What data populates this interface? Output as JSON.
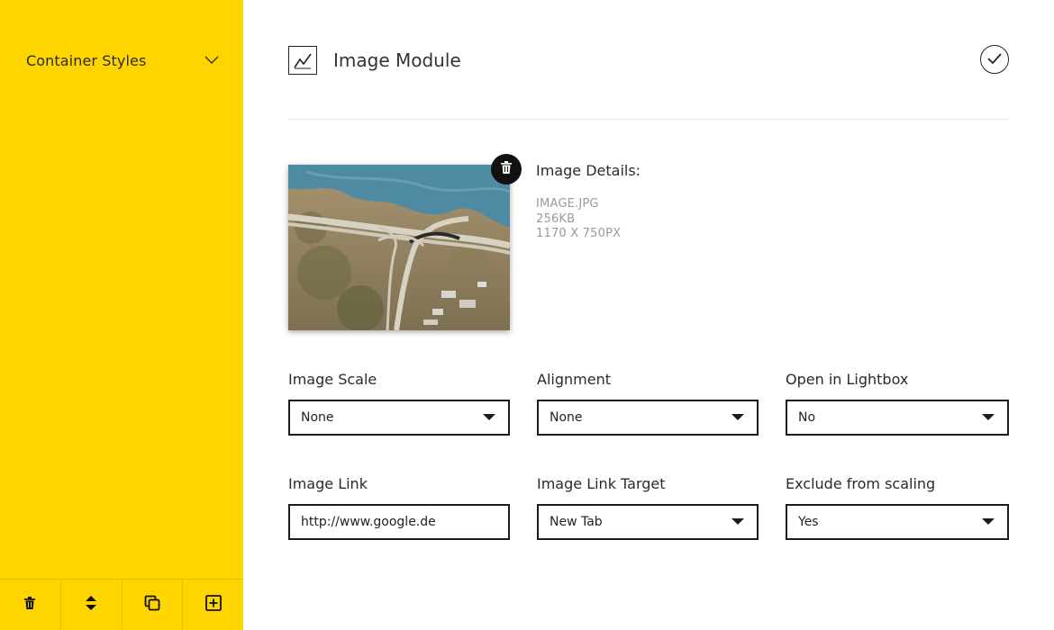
{
  "sidebar": {
    "section_label": "Container Styles",
    "toolbar": [
      {
        "name": "delete-container-button",
        "icon": "trash-icon"
      },
      {
        "name": "move-container-button",
        "icon": "move-updown-icon"
      },
      {
        "name": "duplicate-container-button",
        "icon": "copy-icon"
      },
      {
        "name": "add-container-button",
        "icon": "plus-square-icon"
      }
    ]
  },
  "module": {
    "title": "Image Module",
    "icon": "image-chart-icon",
    "confirm_icon": "check-circle-icon"
  },
  "image": {
    "details_title": "Image Details:",
    "filename": "IMAGE.JPG",
    "size": "256KB",
    "dimensions": "1170 X 750PX"
  },
  "form": {
    "image_scale": {
      "label": "Image Scale",
      "value": "None"
    },
    "alignment": {
      "label": "Alignment",
      "value": "None"
    },
    "open_in_lightbox": {
      "label": "Open in Lightbox",
      "value": "No"
    },
    "image_link": {
      "label": "Image Link",
      "value": "http://www.google.de"
    },
    "image_link_target": {
      "label": "Image Link Target",
      "value": "New Tab"
    },
    "exclude_from_scaling": {
      "label": "Exclude from scaling",
      "value": "Yes"
    }
  },
  "colors": {
    "sidebar_bg": "#FFD500",
    "text": "#2b2b2b",
    "muted": "#9a9a9a",
    "border": "#1c1c1c"
  }
}
